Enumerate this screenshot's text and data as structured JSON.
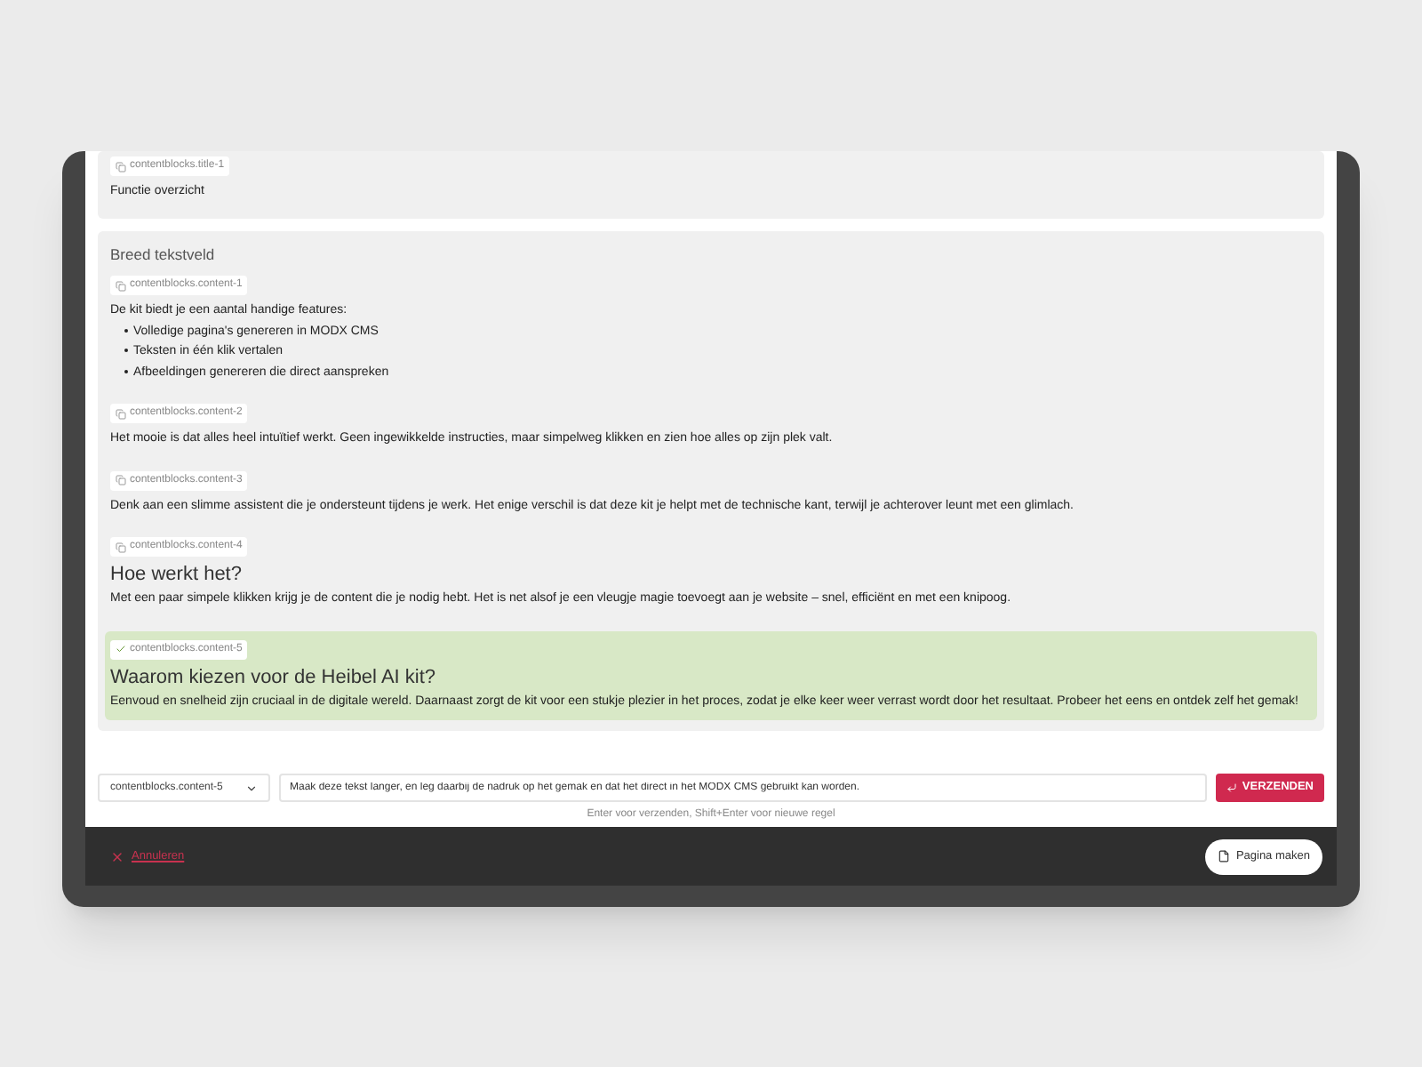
{
  "sections": [
    {
      "items": [
        {
          "tag": "contentblocks.title-1",
          "selected": false,
          "kind": "paragraph",
          "text": "Functie overzicht"
        }
      ]
    },
    {
      "heading": "Breed tekstveld",
      "items": [
        {
          "tag": "contentblocks.content-1",
          "selected": false,
          "kind": "list",
          "text": "De kit biedt je een aantal handige features:",
          "bullets": [
            "Volledige pagina's genereren in MODX CMS",
            "Teksten in één klik vertalen",
            "Afbeeldingen genereren die direct aanspreken"
          ]
        },
        {
          "tag": "contentblocks.content-2",
          "selected": false,
          "kind": "paragraph",
          "text": "Het mooie is dat alles heel intuïtief werkt. Geen ingewikkelde instructies, maar simpelweg klikken en zien hoe alles op zijn plek valt."
        },
        {
          "tag": "contentblocks.content-3",
          "selected": false,
          "kind": "paragraph",
          "text": "Denk aan een slimme assistent die je ondersteunt tijdens je werk. Het enige verschil is dat deze kit je helpt met de technische kant, terwijl je achterover leunt met een glimlach."
        },
        {
          "tag": "contentblocks.content-4",
          "selected": false,
          "kind": "heading",
          "title": "Hoe werkt het?",
          "text": "Met een paar simpele klikken krijg je de content die je nodig hebt. Het is net alsof je een vleugje magie toevoegt aan je website – snel, efficiënt en met een knipoog."
        },
        {
          "tag": "contentblocks.content-5",
          "selected": true,
          "kind": "heading",
          "title": "Waarom kiezen voor de Heibel AI kit?",
          "text": "Eenvoud en snelheid zijn cruciaal in de digitale wereld. Daarnaast zorgt de kit voor een stukje plezier in het proces, zodat je elke keer weer verrast wordt door het resultaat. Probeer het eens en ontdek zelf het gemak!"
        }
      ]
    }
  ],
  "prompt": {
    "block_select": "contentblocks.content-5",
    "value": "Maak deze tekst langer, en leg daarbij de nadruk op het gemak en dat het direct in het MODX CMS gebruikt kan worden.",
    "send_button": "VERZENDEN",
    "hint": "Enter voor verzenden, Shift+Enter voor nieuwe regel"
  },
  "footer": {
    "cancel": "Annuleren",
    "create": "Pagina maken"
  }
}
